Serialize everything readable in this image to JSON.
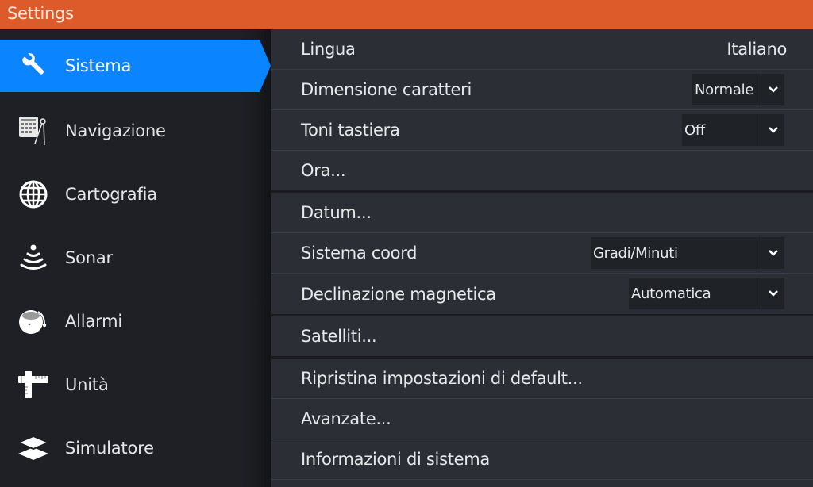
{
  "window": {
    "title": "Settings"
  },
  "colors": {
    "header": "#dd5a2b",
    "selected": "#0a84ff",
    "sidebar_bg": "#1e2025",
    "content_bg": "#2b2f35"
  },
  "sidebar": {
    "items": [
      {
        "label": "Sistema",
        "icon": "wrench-icon",
        "selected": true
      },
      {
        "label": "Navigazione",
        "icon": "navigation-calculator-compass-icon",
        "selected": false
      },
      {
        "label": "Cartografia",
        "icon": "globe-icon",
        "selected": false
      },
      {
        "label": "Sonar",
        "icon": "sonar-icon",
        "selected": false
      },
      {
        "label": "Allarmi",
        "icon": "alarm-bell-icon",
        "selected": false
      },
      {
        "label": "Unità",
        "icon": "ruler-icon",
        "selected": false
      },
      {
        "label": "Simulatore",
        "icon": "layers-icon",
        "selected": false
      }
    ]
  },
  "settings": {
    "rows": [
      {
        "label": "Lingua",
        "value": "Italiano"
      },
      {
        "label": "Dimensione caratteri",
        "dropdown": "Normale"
      },
      {
        "label": "Toni tastiera",
        "dropdown": "Off"
      },
      {
        "label": "Ora..."
      },
      {
        "label": "Datum..."
      },
      {
        "label": "Sistema coord",
        "dropdown": "Gradi/Minuti"
      },
      {
        "label": "Declinazione magnetica",
        "dropdown": "Automatica"
      },
      {
        "label": "Satelliti..."
      },
      {
        "label": "Ripristina impostazioni di default..."
      },
      {
        "label": "Avanzate..."
      },
      {
        "label": "Informazioni di sistema"
      }
    ]
  }
}
